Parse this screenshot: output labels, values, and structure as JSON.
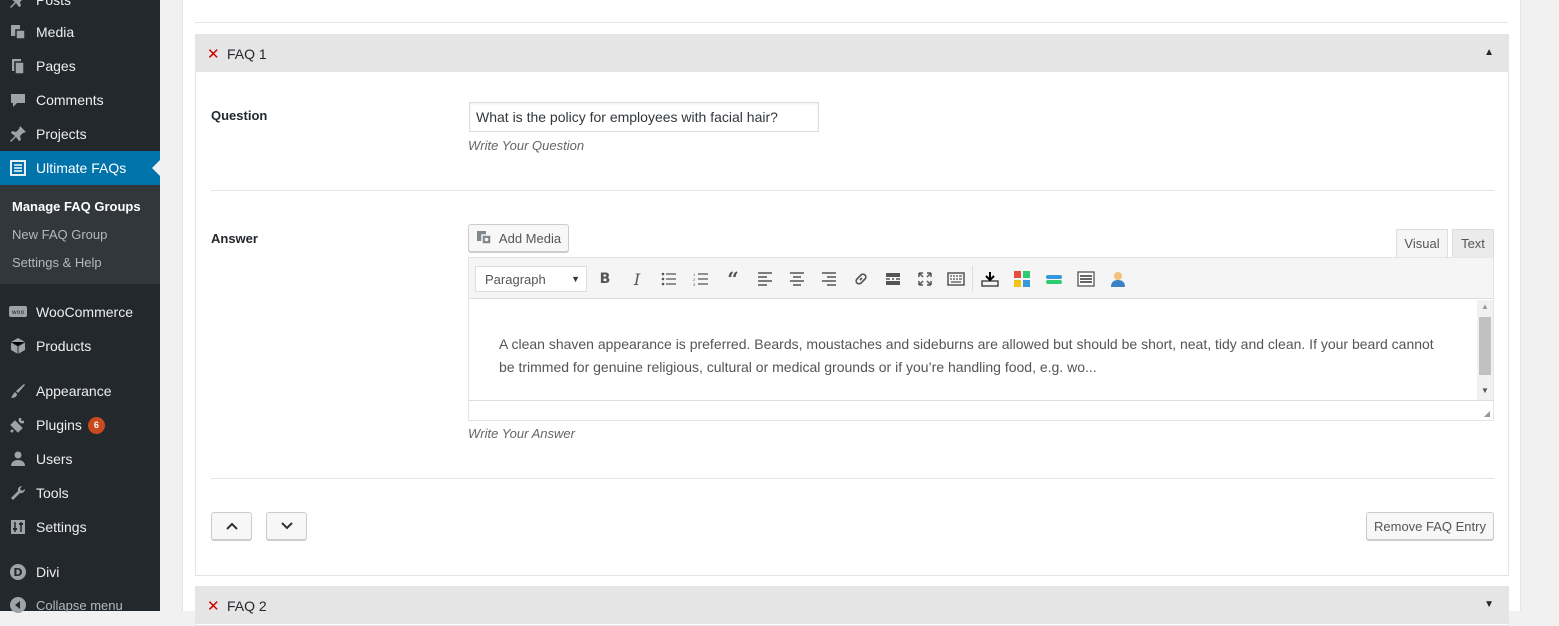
{
  "sidebar": {
    "items": [
      {
        "label": "Posts",
        "icon": "pin-icon"
      },
      {
        "label": "Media",
        "icon": "media-icon"
      },
      {
        "label": "Pages",
        "icon": "pages-icon"
      },
      {
        "label": "Comments",
        "icon": "comments-icon"
      },
      {
        "label": "Projects",
        "icon": "pin-icon"
      },
      {
        "label": "Ultimate FAQs",
        "icon": "list-icon"
      },
      {
        "label": "WooCommerce",
        "icon": "woo-icon"
      },
      {
        "label": "Products",
        "icon": "box-icon"
      },
      {
        "label": "Appearance",
        "icon": "brush-icon"
      },
      {
        "label": "Plugins",
        "icon": "plug-icon",
        "badge": "6"
      },
      {
        "label": "Users",
        "icon": "user-icon"
      },
      {
        "label": "Tools",
        "icon": "wrench-icon"
      },
      {
        "label": "Settings",
        "icon": "sliders-icon"
      },
      {
        "label": "Divi",
        "icon": "divi-icon"
      },
      {
        "label": "Collapse menu",
        "icon": "collapse-icon"
      }
    ],
    "submenu": [
      "Manage FAQ Groups",
      "New FAQ Group",
      "Settings & Help"
    ]
  },
  "faq1": {
    "title": "FAQ 1",
    "question_label": "Question",
    "question_value": "What is the policy for employees with facial hair?",
    "question_hint": "Write Your Question",
    "answer_label": "Answer",
    "add_media": "Add Media",
    "tab_visual": "Visual",
    "tab_text": "Text",
    "format_select": "Paragraph",
    "answer_text": "A clean shaven appearance is preferred. Beards, moustaches and sideburns are allowed but should be short, neat, tidy and clean. If your beard cannot be trimmed for genuine religious, cultural or medical grounds or if you’re handling food, e.g. wo...",
    "answer_hint": "Write Your Answer",
    "remove_button": "Remove FAQ Entry"
  },
  "faq2": {
    "title": "FAQ 2"
  },
  "colors": {
    "sidebar_bg": "#23282d",
    "accent": "#0073aa",
    "badge": "#ca4a1f",
    "remove_x": "#cc0000"
  }
}
